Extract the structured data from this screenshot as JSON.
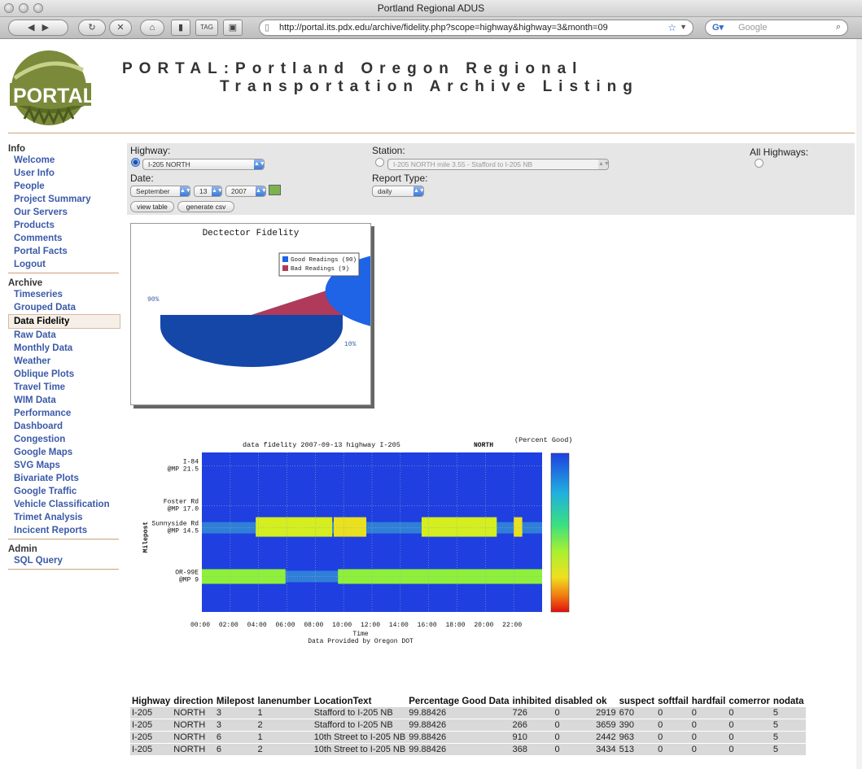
{
  "window": {
    "title": "Portland Regional ADUS"
  },
  "browser": {
    "url": "http://portal.its.pdx.edu/archive/fidelity.php?scope=highway&highway=3&month=09",
    "search_placeholder": "Google"
  },
  "header": {
    "title_line1": "PORTAL:Portland Oregon Regional",
    "title_line2": "Transportation Archive Listing",
    "logo_text": "PORTAL"
  },
  "sidebar": {
    "sections": [
      {
        "title": "Info",
        "items": [
          "Welcome",
          "User Info",
          "People",
          "Project Summary",
          "Our Servers",
          "Products",
          "Comments",
          "Portal Facts",
          "Logout"
        ]
      },
      {
        "title": "Archive",
        "items": [
          "Timeseries",
          "Grouped Data",
          "Data Fidelity",
          "Raw Data",
          "Monthly Data",
          "Weather",
          "Oblique Plots",
          "Travel Time",
          "WIM Data",
          "Performance",
          "Dashboard",
          "Congestion",
          "Google Maps",
          "SVG Maps",
          "Bivariate Plots",
          "Google Traffic",
          "Vehicle Classification",
          "Trimet Analysis",
          "Incicent Reports"
        ]
      },
      {
        "title": "Admin",
        "items": [
          "SQL Query"
        ]
      }
    ],
    "active": "Data Fidelity"
  },
  "form": {
    "highway_label": "Highway:",
    "highway_value": "I-205 NORTH",
    "station_label": "Station:",
    "station_value": "I-205 NORTH mile 3.55 - Stafford to I-205 NB",
    "all_highways_label": "All Highways:",
    "date_label": "Date:",
    "month": "September",
    "day": "13",
    "year": "2007",
    "report_type_label": "Report Type:",
    "report_type": "daily",
    "view_table": "view table",
    "generate_csv": "generate csv"
  },
  "chart_data": [
    {
      "type": "pie",
      "title": "Dectector Fidelity",
      "labels": [
        "Good Readings (90)",
        "Bad Readings (9)"
      ],
      "values": [
        90,
        10
      ],
      "slice_labels": [
        "90%",
        "10%"
      ],
      "colors": [
        "#1f63e6",
        "#b03a5a"
      ],
      "legend": "top-right"
    },
    {
      "type": "heatmap",
      "title": "data fidelity  2007-09-13 highway I-205",
      "direction": "NORTH",
      "scale_label": "(Percent Good)",
      "xlabel": "Time",
      "ylabel": "Milepost",
      "footer": "Data Provided by Oregon DOT",
      "x_ticks": [
        "00:00",
        "02:00",
        "04:00",
        "06:00",
        "08:00",
        "10:00",
        "12:00",
        "14:00",
        "16:00",
        "18:00",
        "20:00",
        "22:00"
      ],
      "y_ticks": [
        {
          "name": "I-84",
          "milepost": "@MP 21.5"
        },
        {
          "name": "Foster Rd",
          "milepost": "@MP 17.0"
        },
        {
          "name": "Sunnyside Rd",
          "milepost": "@MP 14.5"
        },
        {
          "name": "OR-99E",
          "milepost": "@MP 9"
        }
      ],
      "bands": [
        {
          "milepost": 14.5,
          "segments": [
            {
              "from": 3.8,
              "to": 9.2,
              "color": "#d4ee20"
            },
            {
              "from": 9.3,
              "to": 11.6,
              "color": "#e9e020"
            },
            {
              "from": 15.5,
              "to": 20.8,
              "color": "#d4ee20"
            },
            {
              "from": 22.0,
              "to": 22.6,
              "color": "#e9e020"
            }
          ]
        },
        {
          "milepost": 9,
          "segments": [
            {
              "from": 0,
              "to": 5.9,
              "color": "#8ef03a"
            },
            {
              "from": 9.6,
              "to": 24,
              "color": "#8ef03a"
            }
          ]
        }
      ]
    }
  ],
  "table": {
    "headers": [
      "Highway",
      "direction",
      "Milepost",
      "lanenumber",
      "LocationText",
      "Percentage Good Data",
      "inhibited",
      "disabled",
      "ok",
      "suspect",
      "softfail",
      "hardfail",
      "comerror",
      "nodata"
    ],
    "rows": [
      [
        "I-205",
        "NORTH",
        "3",
        "1",
        "Stafford to I-205 NB",
        "99.88426",
        "726",
        "0",
        "2919",
        "670",
        "0",
        "0",
        "0",
        "5"
      ],
      [
        "I-205",
        "NORTH",
        "3",
        "2",
        "Stafford to I-205 NB",
        "99.88426",
        "266",
        "0",
        "3659",
        "390",
        "0",
        "0",
        "0",
        "5"
      ],
      [
        "I-205",
        "NORTH",
        "6",
        "1",
        "10th Street to I-205 NB",
        "99.88426",
        "910",
        "0",
        "2442",
        "963",
        "0",
        "0",
        "0",
        "5"
      ],
      [
        "I-205",
        "NORTH",
        "6",
        "2",
        "10th Street to I-205 NB",
        "99.88426",
        "368",
        "0",
        "3434",
        "513",
        "0",
        "0",
        "0",
        "5"
      ]
    ]
  }
}
